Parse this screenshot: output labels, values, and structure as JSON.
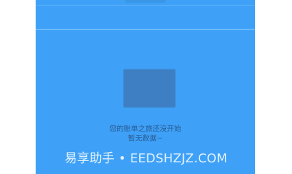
{
  "colors": {
    "screen_background": "#3ea1f7",
    "placeholder_block": "#3e7fc4",
    "empty_text": "#2a5b93",
    "divider": "#6dbafb"
  },
  "empty_state": {
    "line1": "您的账单之旅还没开始",
    "line2": "暂无数据~",
    "illustration": "empty-bill-illustration"
  },
  "watermark": {
    "text": "易享助手 • EEDSHZJZ.COM"
  }
}
